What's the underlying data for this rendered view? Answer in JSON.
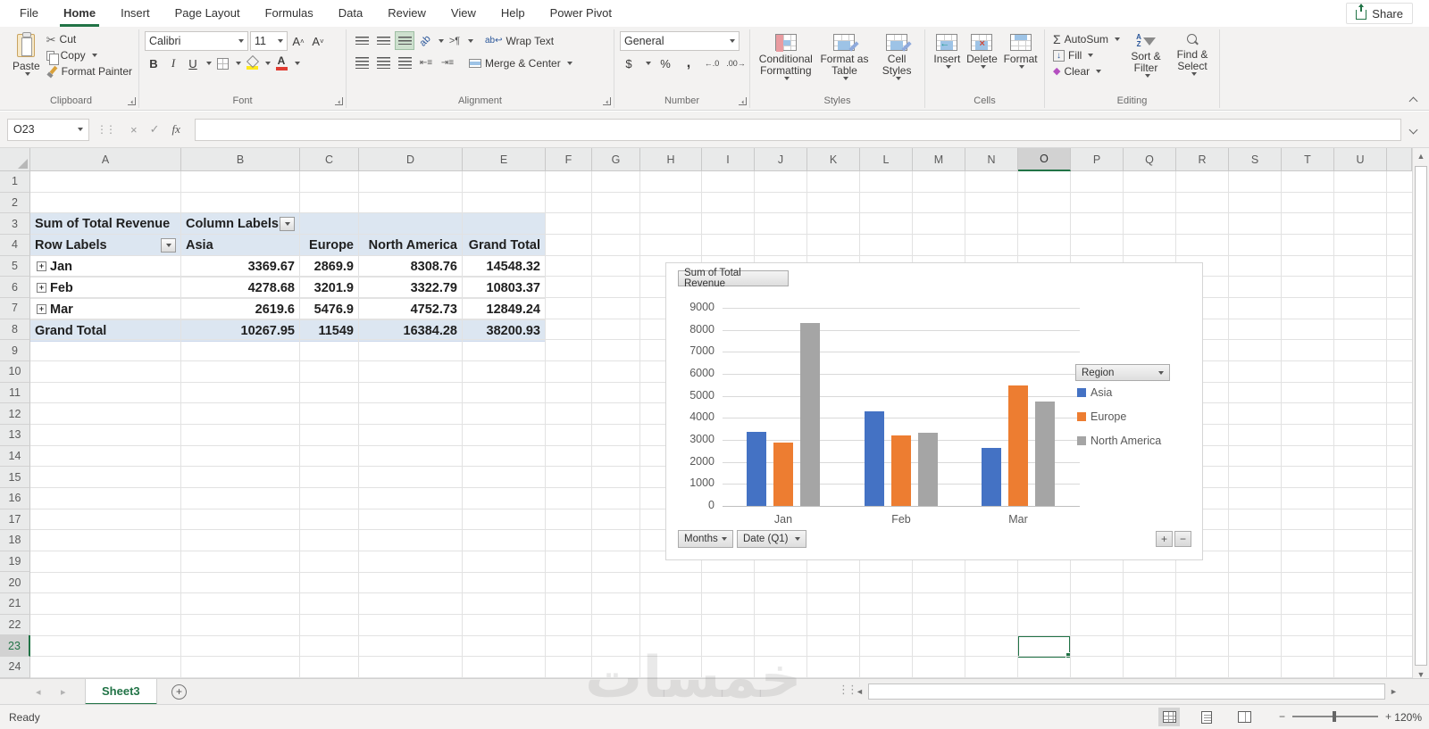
{
  "app": {
    "share_label": "Share"
  },
  "active_tab": "Home",
  "ribbon_tabs": [
    {
      "label": "File"
    },
    {
      "label": "Home"
    },
    {
      "label": "Insert"
    },
    {
      "label": "Page Layout"
    },
    {
      "label": "Formulas"
    },
    {
      "label": "Data"
    },
    {
      "label": "Review"
    },
    {
      "label": "View"
    },
    {
      "label": "Help"
    },
    {
      "label": "Power Pivot"
    }
  ],
  "ribbon": {
    "clipboard": {
      "title": "Clipboard",
      "paste": "Paste",
      "cut": "Cut",
      "copy": "Copy",
      "format_painter": "Format Painter"
    },
    "font": {
      "title": "Font",
      "font_name": "Calibri",
      "font_size": "11",
      "bold": "B",
      "italic": "I",
      "underline": "U",
      "grow": "A",
      "shrink": "A"
    },
    "alignment": {
      "title": "Alignment",
      "wrap_text": "Wrap Text",
      "merge_center": "Merge & Center"
    },
    "number": {
      "title": "Number",
      "format": "General",
      "currency": "$",
      "percent": "%",
      "comma": ",",
      "inc_decimal": "←.0",
      "dec_decimal": ".00→"
    },
    "styles": {
      "title": "Styles",
      "conditional": "Conditional Formatting",
      "format_table": "Format as Table",
      "cell_styles": "Cell Styles"
    },
    "cells": {
      "title": "Cells",
      "insert": "Insert",
      "delete": "Delete",
      "format": "Format"
    },
    "editing": {
      "title": "Editing",
      "autosum": "AutoSum",
      "fill": "Fill",
      "clear": "Clear",
      "sort_filter": "Sort & Filter",
      "find_select": "Find & Select"
    }
  },
  "formula_bar": {
    "name_box": "O23",
    "fx_label": "fx",
    "value": ""
  },
  "grid": {
    "columns": [
      "A",
      "B",
      "C",
      "D",
      "E",
      "F",
      "G",
      "H",
      "I",
      "J",
      "K",
      "L",
      "M",
      "N",
      "O",
      "P",
      "Q",
      "R",
      "S",
      "T",
      "U"
    ],
    "row_numbers": [
      1,
      2,
      3,
      4,
      5,
      6,
      7,
      8,
      9,
      10,
      11,
      12,
      13,
      14,
      15,
      16,
      17,
      18,
      19,
      20,
      21,
      22,
      23,
      24
    ],
    "selected_cell": "O23",
    "selected_column": "O",
    "selected_row": 23
  },
  "pivot": {
    "title": "Sum of Total Revenue",
    "column_labels": "Column Labels",
    "row_labels": "Row Labels",
    "col_headers": [
      "Asia",
      "Europe",
      "North America",
      "Grand Total"
    ],
    "rows": [
      {
        "label": "Jan",
        "values": [
          "3369.67",
          "2869.9",
          "8308.76",
          "14548.32"
        ]
      },
      {
        "label": "Feb",
        "values": [
          "4278.68",
          "3201.9",
          "3322.79",
          "10803.37"
        ]
      },
      {
        "label": "Mar",
        "values": [
          "2619.6",
          "5476.9",
          "4752.73",
          "12849.24"
        ]
      }
    ],
    "grand_total": {
      "label": "Grand Total",
      "values": [
        "10267.95",
        "11549",
        "16384.28",
        "38200.93"
      ]
    }
  },
  "chart": {
    "title_button": "Sum of Total Revenue",
    "legend_button": "Region",
    "field_buttons": [
      "Months",
      "Date (Q1)"
    ],
    "plus": "+",
    "minus": "−"
  },
  "chart_data": {
    "type": "bar",
    "title": "Sum of Total Revenue",
    "categories": [
      "Jan",
      "Feb",
      "Mar"
    ],
    "series": [
      {
        "name": "Asia",
        "color": "#4472C4",
        "values": [
          3369.67,
          4278.68,
          2619.6
        ]
      },
      {
        "name": "Europe",
        "color": "#ED7D31",
        "values": [
          2869.9,
          3201.9,
          5476.9
        ]
      },
      {
        "name": "North America",
        "color": "#A5A5A5",
        "values": [
          8308.76,
          3322.79,
          4752.73
        ]
      }
    ],
    "ylim": [
      0,
      9000
    ],
    "ytick": 1000,
    "legend_title": "Region",
    "legend_position": "right",
    "grid": true
  },
  "sheet_bar": {
    "tabs": [
      {
        "label": "Sheet3",
        "active": true
      }
    ]
  },
  "status_bar": {
    "mode": "Ready",
    "zoom": "120%"
  },
  "watermark": {
    "text": "خمسات"
  },
  "icons": {
    "scissors": "✂",
    "check": "✓",
    "cancel": "×",
    "sigma": "Σ",
    "fill_down": "↓",
    "clear_diamond": "◆",
    "up_arrow": "▲",
    "down_arrow": "▼",
    "left_arrow": "◄",
    "right_arrow": "►",
    "small_left": "◂",
    "small_right": "▸",
    "dots": "⋮⋮",
    "plus": "+"
  }
}
